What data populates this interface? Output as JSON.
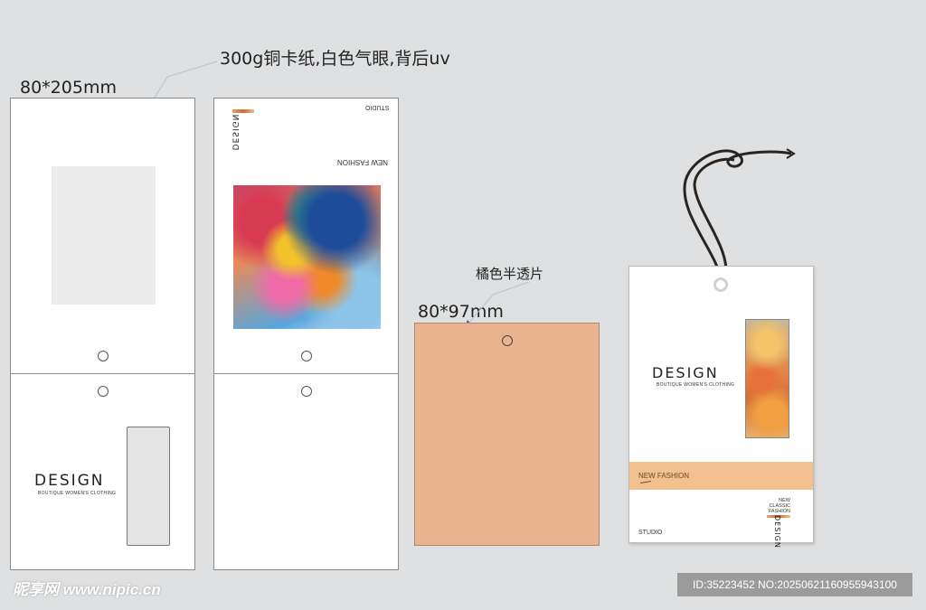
{
  "annotations": {
    "material": "300g铜卡纸,白色气眼,背后uv",
    "size_large": "80*205mm",
    "translucent": "橘色半透片",
    "size_small": "80*97mm"
  },
  "tag": {
    "brand": "DESIGN",
    "tagline": "BOUTIQUE WOMEN'S CLOTHING",
    "new_fashion": "NEW FASHION",
    "studio": "STUDIO",
    "new": "NEW",
    "classic": "CLASSIC",
    "fashion": "FASHION"
  },
  "watermark": {
    "site": "昵享网 www.nipic.cn",
    "id": "ID:35223452 NO:20250621160955943100"
  },
  "colors": {
    "background": "#dfe0e1",
    "orange_sheet": "#e8b38e",
    "orange_band": "#f3c08f"
  }
}
